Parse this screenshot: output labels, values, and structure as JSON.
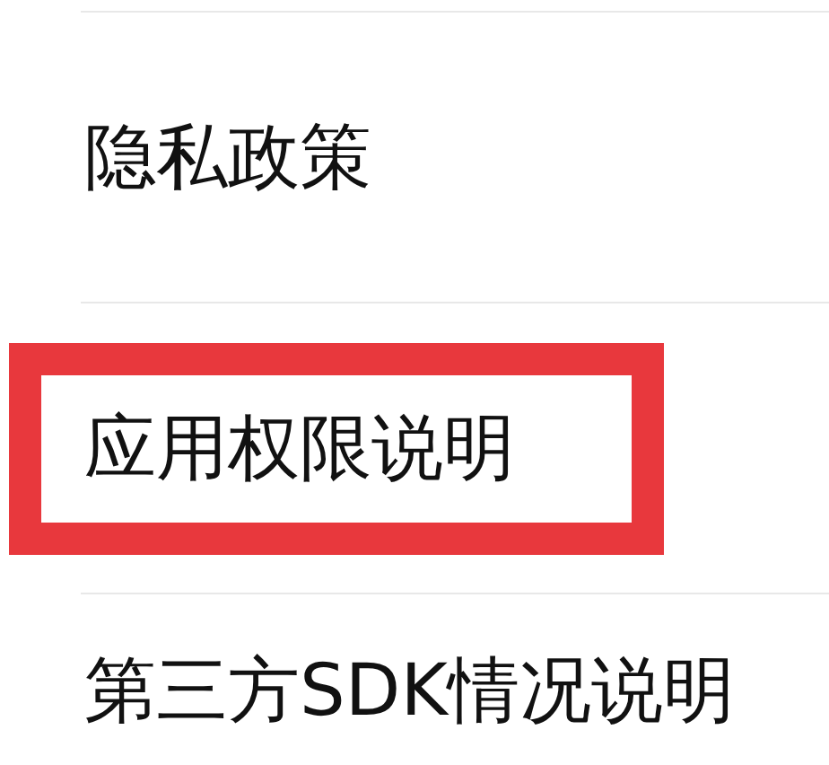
{
  "settings_list": [
    {
      "label": "隐私政策",
      "highlighted": false
    },
    {
      "label": "应用权限说明",
      "highlighted": true
    },
    {
      "label": "第三方SDK情况说明",
      "highlighted": false
    }
  ]
}
